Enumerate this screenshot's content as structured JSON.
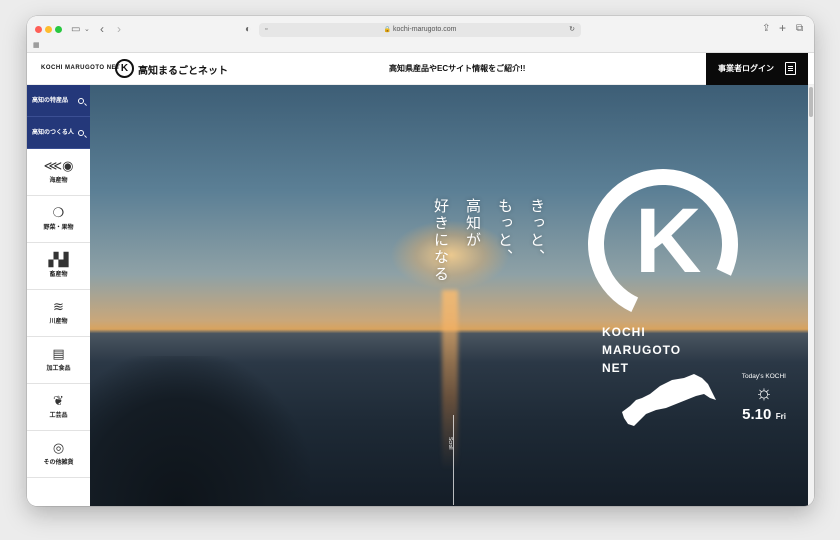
{
  "browser": {
    "url": "kochi-marugoto.com"
  },
  "header": {
    "brand_small": "KOCHI MARUGOTO NET",
    "brand_mark": "K",
    "brand_jp": "高知まるごとネット",
    "tagline": "高知県産品やECサイト情報をご紹介!!",
    "login_label": "事業者ログイン"
  },
  "sidebar": {
    "search_items": [
      {
        "label": "高知の特産品"
      },
      {
        "label": "高知のつくる人"
      }
    ],
    "categories": [
      {
        "label": "海産物",
        "icon": "fish-icon"
      },
      {
        "label": "野菜・果物",
        "icon": "fruit-icon"
      },
      {
        "label": "畜産物",
        "icon": "cow-icon"
      },
      {
        "label": "川産物",
        "icon": "waves-icon"
      },
      {
        "label": "加工食品",
        "icon": "processed-food-icon"
      },
      {
        "label": "工芸品",
        "icon": "craft-icon"
      },
      {
        "label": "その他雑貨",
        "icon": "misc-icon"
      }
    ]
  },
  "hero": {
    "catch_lines": [
      "きっと、",
      "もっと、",
      "高知が",
      "好きになる"
    ],
    "logo_lines": [
      "KOCHI",
      "MARUGOTO",
      "NET"
    ],
    "logo_mark": "K",
    "weather_label": "Today's KOCHI",
    "weather_icon": "sun-icon",
    "date": "5.10",
    "day": "Fri",
    "scroll_label": "Scroll"
  }
}
